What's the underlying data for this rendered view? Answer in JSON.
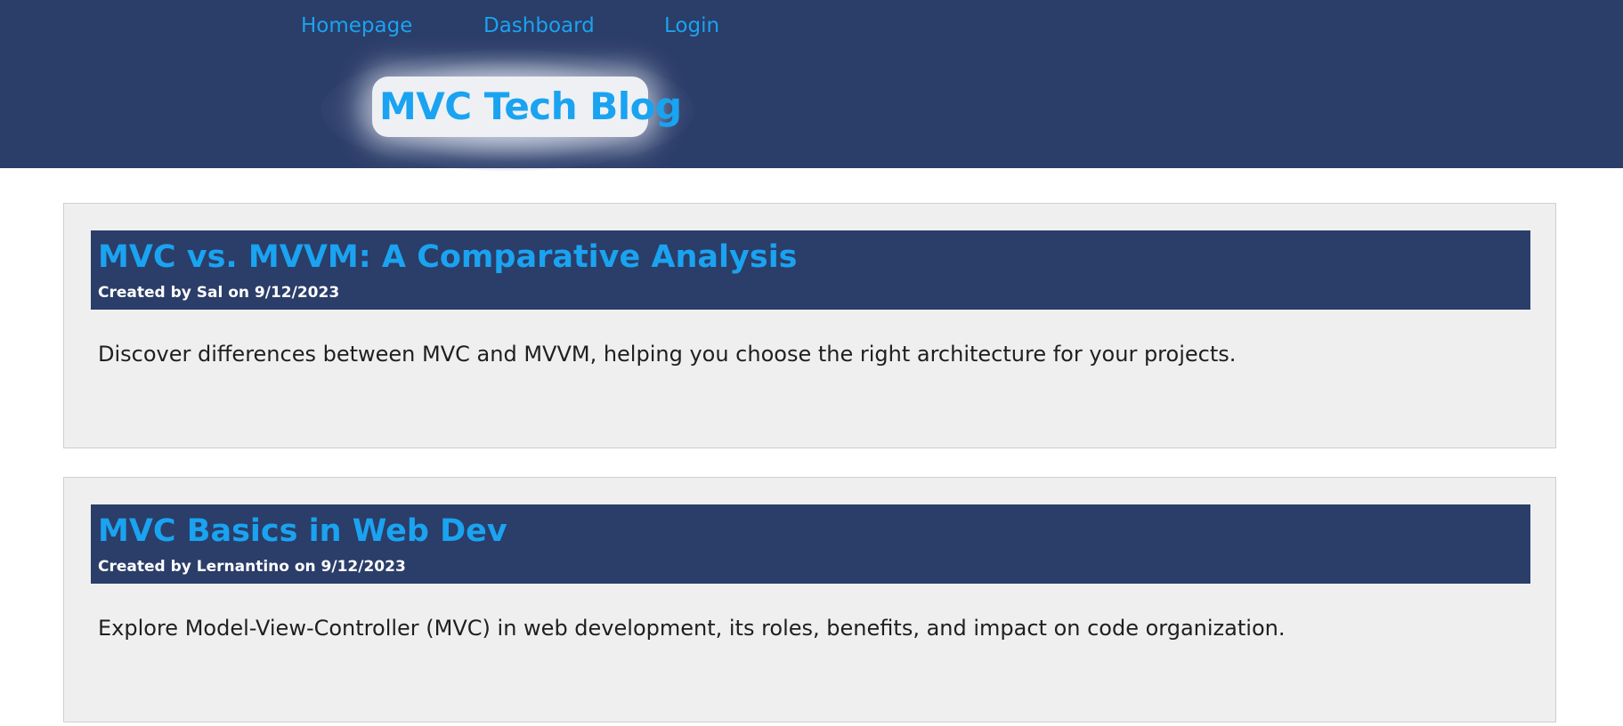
{
  "nav": {
    "items": [
      {
        "label": "Homepage"
      },
      {
        "label": "Dashboard"
      },
      {
        "label": "Login"
      }
    ]
  },
  "brand": {
    "title": "MVC Tech Blog"
  },
  "posts": [
    {
      "title": "MVC vs. MVVM: A Comparative Analysis",
      "meta": "Created by Sal on 9/12/2023",
      "body": "Discover differences between MVC and MVVM, helping you choose the right architecture for your projects."
    },
    {
      "title": "MVC Basics in Web Dev",
      "meta": "Created by Lernantino on 9/12/2023",
      "body": "Explore Model-View-Controller (MVC) in web development, its roles, benefits, and impact on code organization."
    }
  ],
  "colors": {
    "header_bg": "#2b3d69",
    "accent": "#1aa3f0",
    "card_bg": "#efefef"
  }
}
